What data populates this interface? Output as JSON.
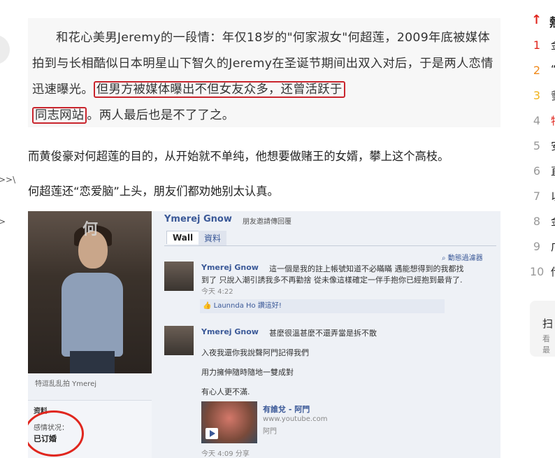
{
  "quote": {
    "line1": "和花心美男Jeremy的一段情：年仅18岁的\"何家淑女\"何超莲，2009年底被媒体拍到与长相酷似日本明星山下智久的Jeremy在圣诞节期间出双入对后，于是两人恋情迅速曝光。",
    "highlight1": "但男方被媒体曝出不但女友众多，还曾活跃于",
    "highlight2": "同志网站",
    "tail": "。两人最后也是不了了之。"
  },
  "paragraphs": [
    "而黄俊豪对何超莲的目的，从开始就不单纯，他想要做赌王的女婿，攀上这个高枝。",
    "何超莲还“恋爱脑”上头，朋友们都劝她别太认真。"
  ],
  "screenshot": {
    "photo_tag": "何",
    "caption": "特逗乱乱拍   Ymerej",
    "info_title": "资料",
    "info_label": "感情状况：",
    "info_value": "已订婚",
    "profile_name": "Ymerej Gnow",
    "profile_sub": "朋友邀請傳回覆",
    "tab_wall": "Wall",
    "tab_info": "資料",
    "search": "動態過濾器",
    "post1": {
      "name": "Ymerej Gnow",
      "text1": "這一個是我的註上帳號知道不必瞞瞞  遇能想得到的我都找",
      "text2": "到了  只說入潮引誘我多不再勸捨  從未像這樣確定一伴手抱你已經抱到最背了.",
      "time": "今天 4:22"
    },
    "like_text": "Launnda Ho 讚這好!",
    "post2": {
      "name": "Ymerej Gnow",
      "text1": "甚麼很溫甚麼不還弄當是拆不散",
      "text2": "入夜我還你我說聲阿門記得我們",
      "text3": "用力擁伸隨時隨地一雙成對",
      "text4": "有心人更不滿.",
      "time": "今天 4:09    分享"
    },
    "video": {
      "title": "有誰兌 - 阿門",
      "url": "www.youtube.com",
      "channel": "阿門"
    }
  },
  "sidebar": {
    "header_icon": "↑",
    "header_text": "熱",
    "items": [
      {
        "num": "1",
        "text": "金",
        "color": "#e0261e"
      },
      {
        "num": "2",
        "text": "“",
        "color": "#f08a1c"
      },
      {
        "num": "3",
        "text": "爹",
        "color": "#f0b31c"
      },
      {
        "num": "4",
        "text": "特",
        "color": "#999999"
      },
      {
        "num": "5",
        "text": "安",
        "color": "#999999"
      },
      {
        "num": "6",
        "text": "直",
        "color": "#999999"
      },
      {
        "num": "7",
        "text": "以",
        "color": "#999999"
      },
      {
        "num": "8",
        "text": "金",
        "color": "#999999"
      },
      {
        "num": "9",
        "text": "广",
        "color": "#999999"
      },
      {
        "num": "10",
        "text": "传",
        "color": "#999999"
      }
    ],
    "item_highlight_color": "#e0261e",
    "scan_title": "扫",
    "scan_sub": "看最"
  }
}
